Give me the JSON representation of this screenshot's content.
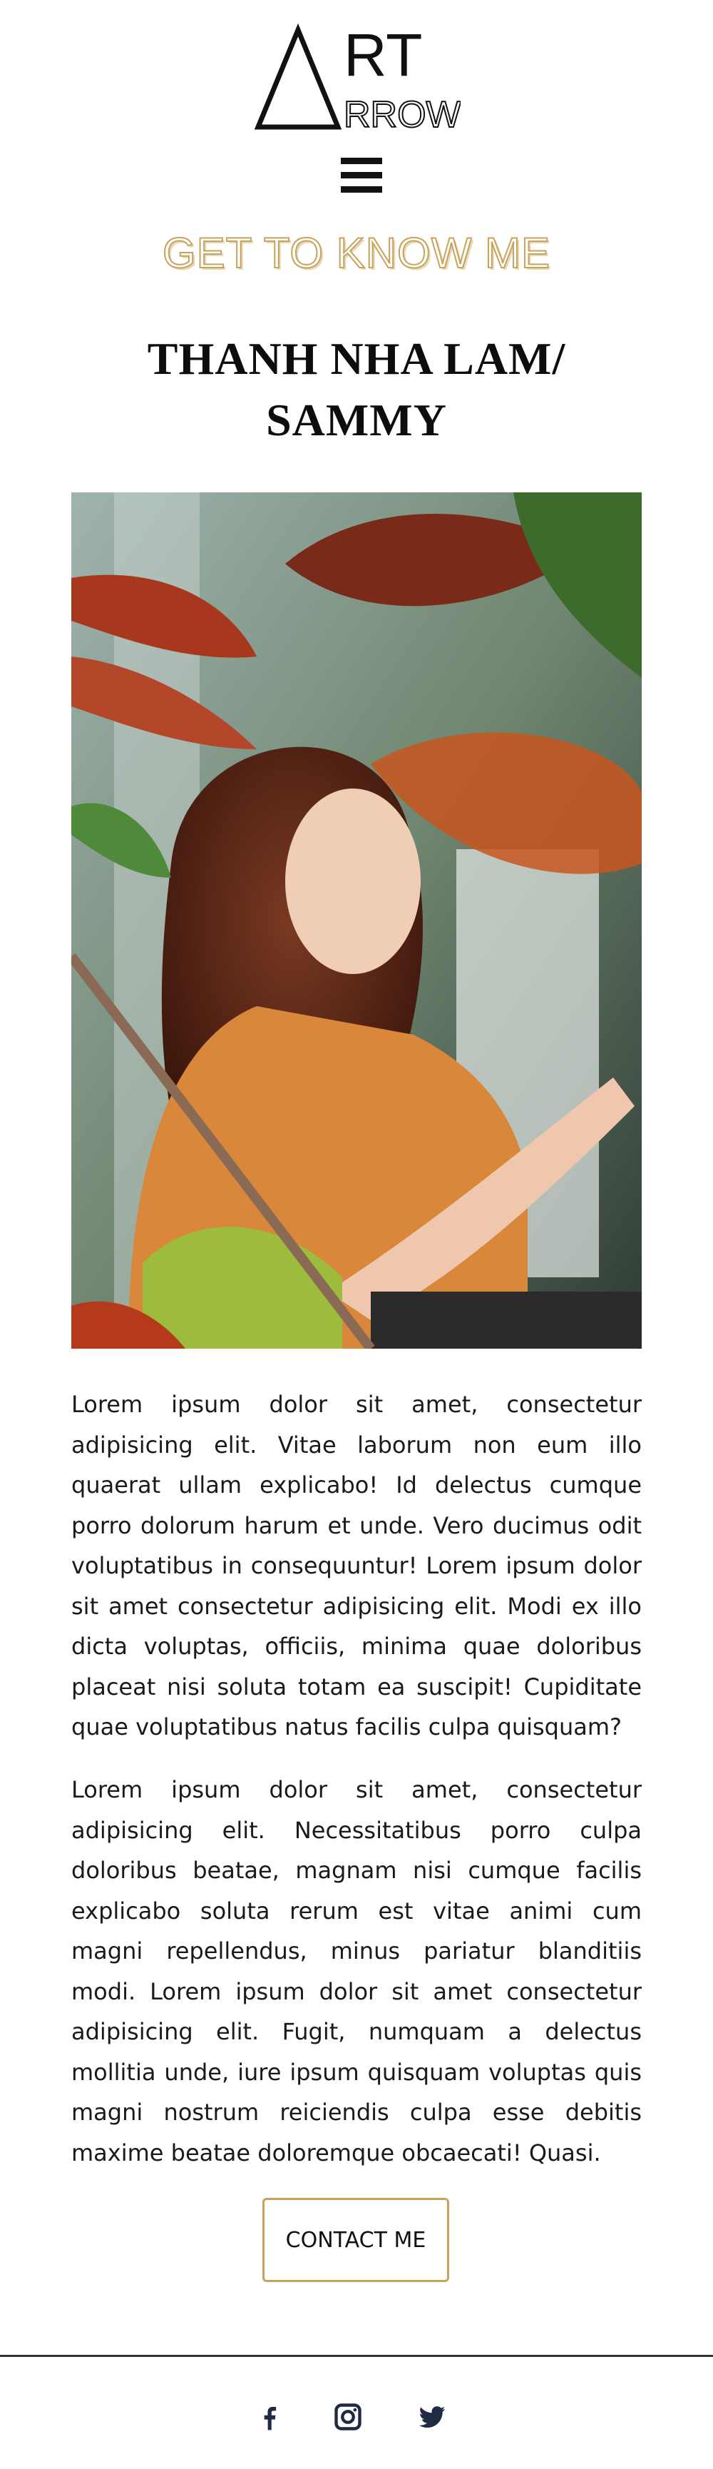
{
  "brand": {
    "logo_text": "ART ARROW"
  },
  "nav": {
    "menu_icon": "hamburger-icon"
  },
  "kicker": "GET TO KNOW ME",
  "profile": {
    "name": "THANH NHA LAM/ SAMMY",
    "photo_alt": "Portrait of woman in orange top behind leaves"
  },
  "about": {
    "paragraph_1": "Lorem ipsum dolor sit amet, consectetur adipisicing elit. Vitae laborum non eum illo quaerat ullam explicabo! Id delectus cumque porro dolorum harum et unde. Vero ducimus odit voluptatibus in consequuntur! Lorem ipsum dolor sit amet consectetur adipisicing elit. Modi ex illo dicta voluptas, officiis, minima quae doloribus placeat nisi soluta totam ea suscipit! Cupiditate quae voluptatibus natus facilis culpa quisquam?",
    "paragraph_2": "Lorem ipsum dolor sit amet, consectetur adipisicing elit. Necessitatibus porro culpa doloribus beatae, magnam nisi cumque facilis explicabo soluta rerum est vitae animi cum magni repellendus, minus pariatur blanditiis modi. Lorem ipsum dolor sit amet consectetur adipisicing elit. Fugit, numquam a delectus mollitia unde, iure ipsum quisquam voluptas quis magni nostrum reiciendis culpa esse debitis maxime beatae doloremque obcaecati! Quasi."
  },
  "cta": {
    "contact_label": "CONTACT ME"
  },
  "footer": {
    "social": [
      {
        "icon": "facebook-icon"
      },
      {
        "icon": "instagram-icon"
      },
      {
        "icon": "twitter-icon"
      }
    ]
  },
  "colors": {
    "accent": "#c9a25c",
    "text": "#111111",
    "background": "#ffffff"
  }
}
